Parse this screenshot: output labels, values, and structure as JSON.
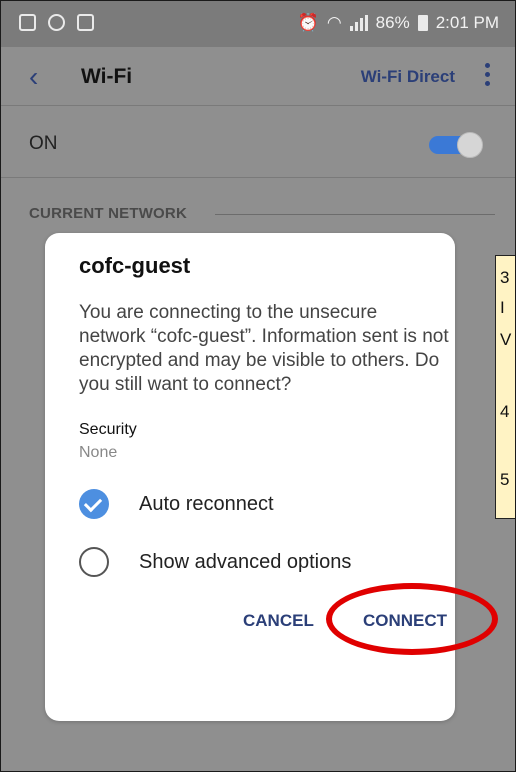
{
  "status_bar": {
    "battery": "86%",
    "time": "2:01 PM"
  },
  "app_bar": {
    "title": "Wi-Fi",
    "action": "Wi-Fi Direct"
  },
  "wifi_toggle": {
    "label": "ON",
    "state": "on"
  },
  "section": {
    "current_network": "CURRENT NETWORK"
  },
  "dialog": {
    "title": "cofc-guest",
    "message": "You are connecting to the unsecure network “cofc-guest”. Information sent is not encrypted and may be visible to others. Do you still want to connect?",
    "security_label": "Security",
    "security_value": "None",
    "auto_reconnect": "Auto reconnect",
    "advanced_options": "Show advanced options",
    "cancel": "CANCEL",
    "connect": "CONNECT"
  },
  "callout": {
    "lines": [
      "3",
      "I",
      "V",
      "4",
      "5"
    ]
  },
  "colors": {
    "accent": "#2b3f78",
    "toggle_on": "#3b79d6",
    "checkbox": "#4d8fe0",
    "highlight": "#e00000"
  }
}
